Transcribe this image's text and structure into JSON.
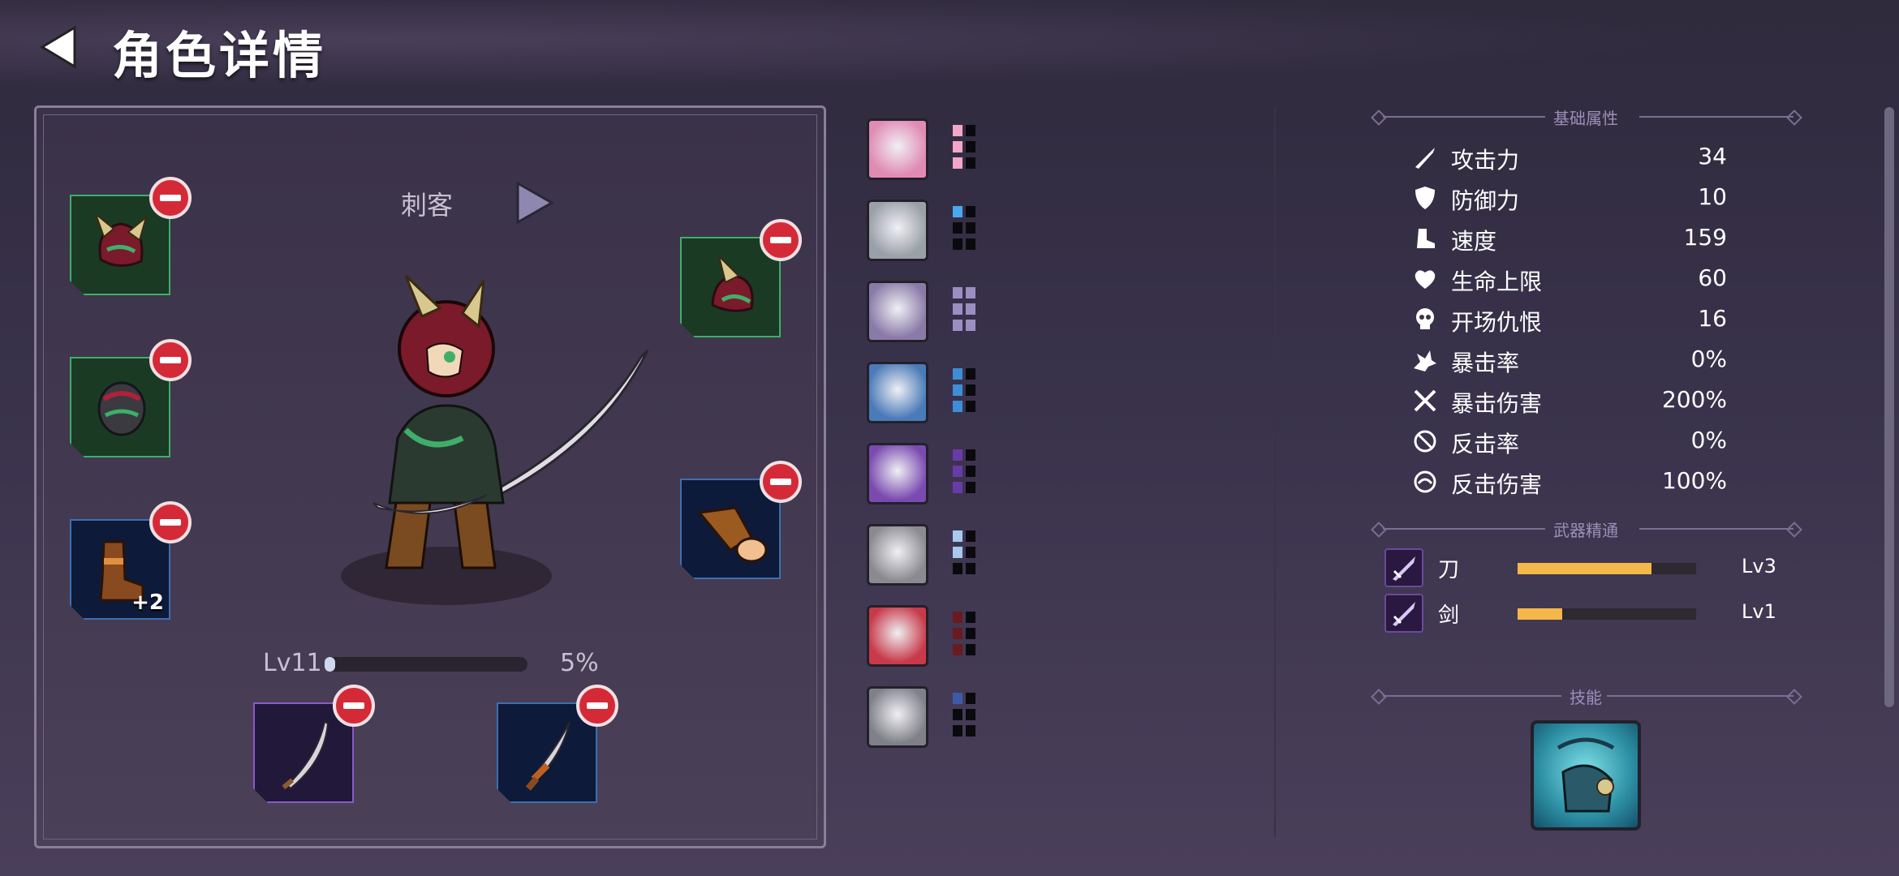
{
  "header": {
    "title": "角色详情",
    "back_icon": "back-arrow-icon"
  },
  "character": {
    "class_name": "刺客",
    "level_label": "Lv11",
    "xp_percent_label": "5%",
    "xp_fraction": 0.05,
    "boots_bonus": "+2"
  },
  "equipment_icons": [
    {
      "name": "boots-icon",
      "color": "#e08ab4",
      "pips": [
        "#f4a6c8",
        "#f4a6c8",
        "#f4a6c8"
      ]
    },
    {
      "name": "armor-plate-icon",
      "color": "#9aa0a8",
      "pips": [
        "#4aa8f0"
      ]
    },
    {
      "name": "warrior-portrait-icon",
      "color": "#8a7aa8",
      "pips": [
        "#9a8fc0",
        "#9a8fc0",
        "#9a8fc0",
        "#9a8fc0",
        "#9a8fc0",
        "#9a8fc0"
      ]
    },
    {
      "name": "viking-portrait-icon",
      "color": "#4a7ab8",
      "pips": [
        "#3d8ed8",
        "#3d8ed8",
        "#3d8ed8"
      ]
    },
    {
      "name": "coins-icon",
      "color": "#7a4ab0",
      "pips": [
        "#6a3aa8",
        "#6a3aa8",
        "#6a3aa8"
      ]
    },
    {
      "name": "shield-emblem-icon",
      "color": "#8a8a90",
      "pips": [
        "#a8c8f0",
        "#a8c8f0"
      ]
    },
    {
      "name": "monster-mouth-icon",
      "color": "#c83a4a",
      "pips": [
        "#6a1a20",
        "#6a1a20",
        "#6a1a20"
      ]
    },
    {
      "name": "swirl-orb-icon",
      "color": "#808088",
      "pips": [
        "#3d5aa8"
      ]
    }
  ],
  "stats": {
    "section_title": "基础属性",
    "items": [
      {
        "label": "攻击力",
        "value": "34",
        "icon": "sword-icon"
      },
      {
        "label": "防御力",
        "value": "10",
        "icon": "shield-icon"
      },
      {
        "label": "速度",
        "value": "159",
        "icon": "boot-speed-icon"
      },
      {
        "label": "生命上限",
        "value": "60",
        "icon": "heart-icon"
      },
      {
        "label": "开场仇恨",
        "value": "16",
        "icon": "skull-icon"
      },
      {
        "label": "暴击率",
        "value": "0%",
        "icon": "burst-icon"
      },
      {
        "label": "暴击伤害",
        "value": "200%",
        "icon": "crossed-swords-icon"
      },
      {
        "label": "反击率",
        "value": "0%",
        "icon": "counter-icon"
      },
      {
        "label": "反击伤害",
        "value": "100%",
        "icon": "counter-damage-icon"
      }
    ]
  },
  "weapon_mastery": {
    "section_title": "武器精通",
    "items": [
      {
        "label": "刀",
        "level": "Lv3",
        "progress": 0.75,
        "icon": "blade-icon"
      },
      {
        "label": "剑",
        "level": "Lv1",
        "progress": 0.25,
        "icon": "sword-mastery-icon"
      }
    ]
  },
  "skills": {
    "section_title": "技能",
    "icon": "skill-icon"
  },
  "colors": {
    "accent": "#f5b74a",
    "remove": "#d42a38"
  }
}
